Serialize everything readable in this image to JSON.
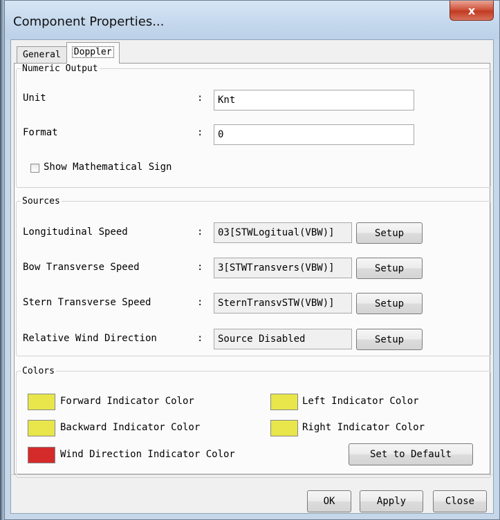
{
  "window": {
    "title": "Component Properties...",
    "close_label": "x"
  },
  "tabs": [
    {
      "label": "General",
      "active": false
    },
    {
      "label": "Doppler",
      "active": true
    }
  ],
  "numeric_output": {
    "legend": "Numeric Output",
    "unit_label": "Unit",
    "unit_value": "Knt",
    "format_label": "Format",
    "format_value": "0",
    "show_sign_label": "Show Mathematical Sign",
    "show_sign_checked": false
  },
  "sources": {
    "legend": "Sources",
    "rows": [
      {
        "label": "Longitudinal Speed",
        "value": "03[STWLogitual(VBW)]",
        "button": "Setup"
      },
      {
        "label": "Bow Transverse Speed",
        "value": "3[STWTransvers(VBW)]",
        "button": "Setup"
      },
      {
        "label": "Stern Transverse Speed",
        "value": "SternTransvSTW(VBW)]",
        "button": "Setup"
      },
      {
        "label": "Relative Wind Direction",
        "value": "Source Disabled",
        "button": "Setup"
      }
    ]
  },
  "colors": {
    "legend": "Colors",
    "forward_label": "Forward Indicator Color",
    "forward_color": "#e8e64a",
    "backward_label": "Backward Indicator Color",
    "backward_color": "#e8e64a",
    "left_label": "Left Indicator Color",
    "left_color": "#e8e64a",
    "right_label": "Right Indicator Color",
    "right_color": "#e8e64a",
    "wind_label": "Wind Direction Indicator Color",
    "wind_color": "#d42a2a",
    "default_button": "Set to Default"
  },
  "footer": {
    "ok": "OK",
    "apply": "Apply",
    "close": "Close"
  }
}
